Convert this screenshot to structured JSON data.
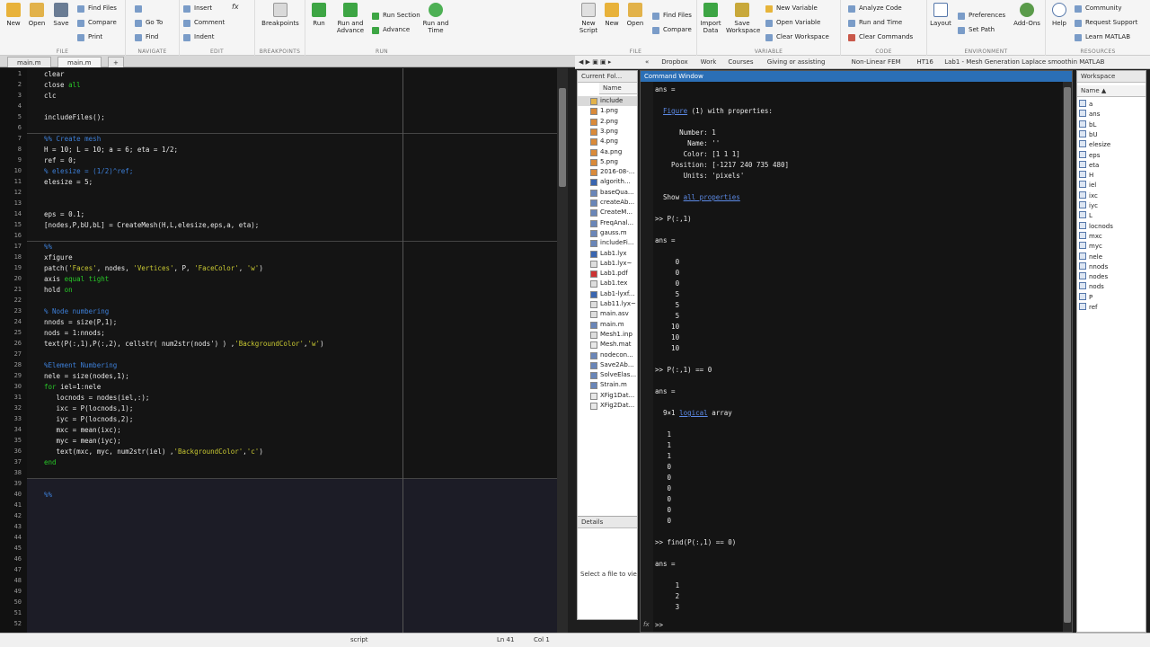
{
  "ribbon_left": {
    "groups": [
      {
        "label": "FILE"
      },
      {
        "label": "NAVIGATE"
      },
      {
        "label": "EDIT"
      },
      {
        "label": "BREAKPOINTS"
      },
      {
        "label": "RUN"
      }
    ],
    "new": "New",
    "open": "Open",
    "save": "Save",
    "find_files": "Find Files",
    "compare": "Compare",
    "print": "Print",
    "go_to": "Go To",
    "find": "Find",
    "insert": "Insert",
    "comment": "Comment",
    "indent": "Indent",
    "fx": "fx",
    "breakpoints": "Breakpoints",
    "run": "Run",
    "run_and_advance": "Run and Advance",
    "run_section": "Run Section",
    "advance": "Advance",
    "run_and_time": "Run and Time"
  },
  "ribbon_right": {
    "groups": [
      {
        "label": "FILE"
      },
      {
        "label": "VARIABLE"
      },
      {
        "label": "CODE"
      },
      {
        "label": "ENVIRONMENT"
      },
      {
        "label": "RESOURCES"
      }
    ],
    "new_script": "New Script",
    "new": "New",
    "open": "Open",
    "find_files": "Find Files",
    "compare": "Compare",
    "import_data": "Import Data",
    "save_workspace": "Save Workspace",
    "new_variable": "New Variable",
    "open_variable": "Open Variable",
    "clear_workspace": "Clear Workspace",
    "analyze_code": "Analyze Code",
    "run_and_time": "Run and Time",
    "clear_commands": "Clear Commands",
    "layout": "Layout",
    "preferences": "Preferences",
    "set_path": "Set Path",
    "add_ons": "Add-Ons",
    "help": "Help",
    "community": "Community",
    "request_support": "Request Support",
    "learn_matlab": "Learn MATLAB"
  },
  "editor": {
    "tabs": [
      "main.m",
      "main.m",
      "+"
    ],
    "line_numbers": [
      "1",
      "2",
      "3",
      "4",
      "5",
      "6",
      "7",
      "8",
      "9",
      "10",
      "11",
      "12",
      "13",
      "14",
      "15",
      "16",
      "17",
      "18",
      "19",
      "20",
      "21",
      "22",
      "23",
      "24",
      "25",
      "26",
      "27",
      "28",
      "29",
      "30",
      "31",
      "32",
      "33",
      "34",
      "35",
      "36",
      "37",
      "38",
      "39",
      "40",
      "41",
      "42",
      "43",
      "44",
      "45",
      "46",
      "47",
      "48",
      "49",
      "50",
      "51",
      "52"
    ],
    "lines": [
      [
        {
          "t": "clear",
          "c": ""
        }
      ],
      [
        {
          "t": "close ",
          "c": ""
        },
        {
          "t": "all",
          "c": "kw"
        }
      ],
      [
        {
          "t": "clc",
          "c": ""
        }
      ],
      [],
      [
        {
          "t": "includeFiles();",
          "c": ""
        }
      ],
      [],
      [
        {
          "t": "%% Create mesh",
          "c": "cm"
        }
      ],
      [
        {
          "t": "H = 10; L = 10; a = 6; eta = 1/2;",
          "c": ""
        }
      ],
      [
        {
          "t": "ref = 0;",
          "c": ""
        }
      ],
      [
        {
          "t": "% elesize = (1/2)^ref;",
          "c": "cm"
        }
      ],
      [
        {
          "t": "elesize = 5;",
          "c": ""
        }
      ],
      [],
      [],
      [
        {
          "t": "eps = 0.1;",
          "c": ""
        }
      ],
      [
        {
          "t": "[nodes,P,bU,bL] = CreateMesh(H,L,elesize,eps,a, eta);",
          "c": ""
        }
      ],
      [],
      [
        {
          "t": "%%",
          "c": "cm"
        }
      ],
      [
        {
          "t": "xfigure",
          "c": ""
        }
      ],
      [
        {
          "t": "patch(",
          "c": ""
        },
        {
          "t": "'Faces'",
          "c": "str"
        },
        {
          "t": ", nodes, ",
          "c": ""
        },
        {
          "t": "'Vertices'",
          "c": "str"
        },
        {
          "t": ", P, ",
          "c": ""
        },
        {
          "t": "'FaceColor'",
          "c": "str"
        },
        {
          "t": ", ",
          "c": ""
        },
        {
          "t": "'w'",
          "c": "str"
        },
        {
          "t": ")",
          "c": ""
        }
      ],
      [
        {
          "t": "axis ",
          "c": ""
        },
        {
          "t": "equal tight",
          "c": "kw"
        }
      ],
      [
        {
          "t": "hold ",
          "c": ""
        },
        {
          "t": "on",
          "c": "kw"
        }
      ],
      [],
      [
        {
          "t": "% Node numbering",
          "c": "cm"
        }
      ],
      [
        {
          "t": "nnods = size(P,1);",
          "c": ""
        }
      ],
      [
        {
          "t": "nods = 1:nnods;",
          "c": ""
        }
      ],
      [
        {
          "t": "text(P(:,1),P(:,2), cellstr( num2str(nods') ) ,",
          "c": ""
        },
        {
          "t": "'BackgroundColor'",
          "c": "str"
        },
        {
          "t": ",",
          "c": ""
        },
        {
          "t": "'w'",
          "c": "str"
        },
        {
          "t": ")",
          "c": ""
        }
      ],
      [],
      [
        {
          "t": "%Element Numbering",
          "c": "cm"
        }
      ],
      [
        {
          "t": "nele = size(nodes,1);",
          "c": ""
        }
      ],
      [
        {
          "t": "for ",
          "c": "kw"
        },
        {
          "t": "iel=1:nele",
          "c": ""
        }
      ],
      [
        {
          "t": "   locnods = nodes(iel,:);",
          "c": ""
        }
      ],
      [
        {
          "t": "   ixc = P(locnods,1);",
          "c": ""
        }
      ],
      [
        {
          "t": "   iyc = P(locnods,2);",
          "c": ""
        }
      ],
      [
        {
          "t": "   mxc = mean(ixc);",
          "c": ""
        }
      ],
      [
        {
          "t": "   myc = mean(iyc);",
          "c": ""
        }
      ],
      [
        {
          "t": "   text(mxc, myc, num2str(iel) ,",
          "c": ""
        },
        {
          "t": "'BackgroundColor'",
          "c": "str"
        },
        {
          "t": ",",
          "c": ""
        },
        {
          "t": "'c'",
          "c": "str"
        },
        {
          "t": ")",
          "c": ""
        }
      ],
      [
        {
          "t": "end",
          "c": "kw"
        }
      ],
      [],
      [],
      [
        {
          "t": "%%",
          "c": "cm"
        }
      ],
      [],
      [],
      [],
      [],
      [],
      [],
      [],
      [],
      [],
      [],
      [],
      []
    ],
    "status": {
      "mode": "script",
      "ln": "Ln  41",
      "col": "Col  1"
    }
  },
  "address": {
    "crumbs": [
      "«",
      "Dropbox",
      "Work",
      "Courses",
      "Giving or assisting",
      "Non-Linear FEM",
      "HT16",
      "Lab1 - Mesh Generation Laplace smoothin MATLAB"
    ]
  },
  "current_folder": {
    "title": "Current Fol...",
    "column": "Name",
    "files": [
      {
        "name": "include",
        "type": "folder"
      },
      {
        "name": "1.png",
        "type": "img"
      },
      {
        "name": "2.png",
        "type": "img"
      },
      {
        "name": "3.png",
        "type": "img"
      },
      {
        "name": "4.png",
        "type": "img"
      },
      {
        "name": "4a.png",
        "type": "img"
      },
      {
        "name": "5.png",
        "type": "img"
      },
      {
        "name": "2016-08-...",
        "type": "img"
      },
      {
        "name": "algorith...",
        "type": "doc"
      },
      {
        "name": "baseQua...",
        "type": "m"
      },
      {
        "name": "createAb...",
        "type": "m"
      },
      {
        "name": "CreateM...",
        "type": "m"
      },
      {
        "name": "FreqAnal...",
        "type": "m"
      },
      {
        "name": "gauss.m",
        "type": "m"
      },
      {
        "name": "includeFi...",
        "type": "m"
      },
      {
        "name": "Lab1.lyx",
        "type": "doc"
      },
      {
        "name": "Lab1.lyx~",
        "type": "txt"
      },
      {
        "name": "Lab1.pdf",
        "type": "pdf"
      },
      {
        "name": "Lab1.tex",
        "type": "txt"
      },
      {
        "name": "Lab1-lyxf...",
        "type": "doc"
      },
      {
        "name": "Lab11.lyx~",
        "type": "txt"
      },
      {
        "name": "main.asv",
        "type": "txt"
      },
      {
        "name": "main.m",
        "type": "m"
      },
      {
        "name": "Mesh1.inp",
        "type": "txt"
      },
      {
        "name": "Mesh.mat",
        "type": "mat"
      },
      {
        "name": "nodecon...",
        "type": "m"
      },
      {
        "name": "Save2Ab...",
        "type": "m"
      },
      {
        "name": "SolveElas...",
        "type": "m"
      },
      {
        "name": "Strain.m",
        "type": "m"
      },
      {
        "name": "XFig1Dat...",
        "type": "mat"
      },
      {
        "name": "XFig2Dat...",
        "type": "mat"
      }
    ],
    "details_title": "Details",
    "details_text": "Select a file to vie"
  },
  "command_window": {
    "title": "Command Window",
    "lines": [
      [
        {
          "t": "ans =",
          "c": ""
        }
      ],
      [],
      [
        {
          "t": "  ",
          "c": ""
        },
        {
          "t": "Figure",
          "c": "lnk"
        },
        {
          "t": " (1) with properties:",
          "c": ""
        }
      ],
      [],
      [
        {
          "t": "      Number: 1",
          "c": ""
        }
      ],
      [
        {
          "t": "        Name: ''",
          "c": ""
        }
      ],
      [
        {
          "t": "       Color: [1 1 1]",
          "c": ""
        }
      ],
      [
        {
          "t": "    Position: [-1217 240 735 480]",
          "c": ""
        }
      ],
      [
        {
          "t": "       Units: 'pixels'",
          "c": ""
        }
      ],
      [],
      [
        {
          "t": "  Show ",
          "c": ""
        },
        {
          "t": "all properties",
          "c": "lnk"
        }
      ],
      [],
      [
        {
          "t": ">> P(:,1)",
          "c": ""
        }
      ],
      [],
      [
        {
          "t": "ans =",
          "c": ""
        }
      ],
      [],
      [
        {
          "t": "     0",
          "c": ""
        }
      ],
      [
        {
          "t": "     0",
          "c": ""
        }
      ],
      [
        {
          "t": "     0",
          "c": ""
        }
      ],
      [
        {
          "t": "     5",
          "c": ""
        }
      ],
      [
        {
          "t": "     5",
          "c": ""
        }
      ],
      [
        {
          "t": "     5",
          "c": ""
        }
      ],
      [
        {
          "t": "    10",
          "c": ""
        }
      ],
      [
        {
          "t": "    10",
          "c": ""
        }
      ],
      [
        {
          "t": "    10",
          "c": ""
        }
      ],
      [],
      [
        {
          "t": ">> P(:,1) == 0",
          "c": ""
        }
      ],
      [],
      [
        {
          "t": "ans =",
          "c": ""
        }
      ],
      [],
      [
        {
          "t": "  9×1 ",
          "c": ""
        },
        {
          "t": "logical",
          "c": "lnk"
        },
        {
          "t": " array",
          "c": ""
        }
      ],
      [],
      [
        {
          "t": "   1",
          "c": ""
        }
      ],
      [
        {
          "t": "   1",
          "c": ""
        }
      ],
      [
        {
          "t": "   1",
          "c": ""
        }
      ],
      [
        {
          "t": "   0",
          "c": ""
        }
      ],
      [
        {
          "t": "   0",
          "c": ""
        }
      ],
      [
        {
          "t": "   0",
          "c": ""
        }
      ],
      [
        {
          "t": "   0",
          "c": ""
        }
      ],
      [
        {
          "t": "   0",
          "c": ""
        }
      ],
      [
        {
          "t": "   0",
          "c": ""
        }
      ],
      [],
      [
        {
          "t": ">> find(P(:,1) == 0)",
          "c": ""
        }
      ],
      [],
      [
        {
          "t": "ans =",
          "c": ""
        }
      ],
      [],
      [
        {
          "t": "     1",
          "c": ""
        }
      ],
      [
        {
          "t": "     2",
          "c": ""
        }
      ],
      [
        {
          "t": "     3",
          "c": ""
        }
      ]
    ],
    "prompt": ">>",
    "fx": "fx"
  },
  "workspace": {
    "title": "Workspace",
    "column": "Name ▲",
    "vars": [
      "a",
      "ans",
      "bL",
      "bU",
      "elesize",
      "eps",
      "eta",
      "H",
      "iel",
      "ixc",
      "iyc",
      "L",
      "locnods",
      "mxc",
      "myc",
      "nele",
      "nnods",
      "nodes",
      "nods",
      "P",
      "ref"
    ]
  },
  "colors": {
    "cmd_title": "#2b6fb6",
    "keyword": "#28c828",
    "string": "#c8c832",
    "comment": "#3d7fd8",
    "link": "#5c8ae6"
  }
}
